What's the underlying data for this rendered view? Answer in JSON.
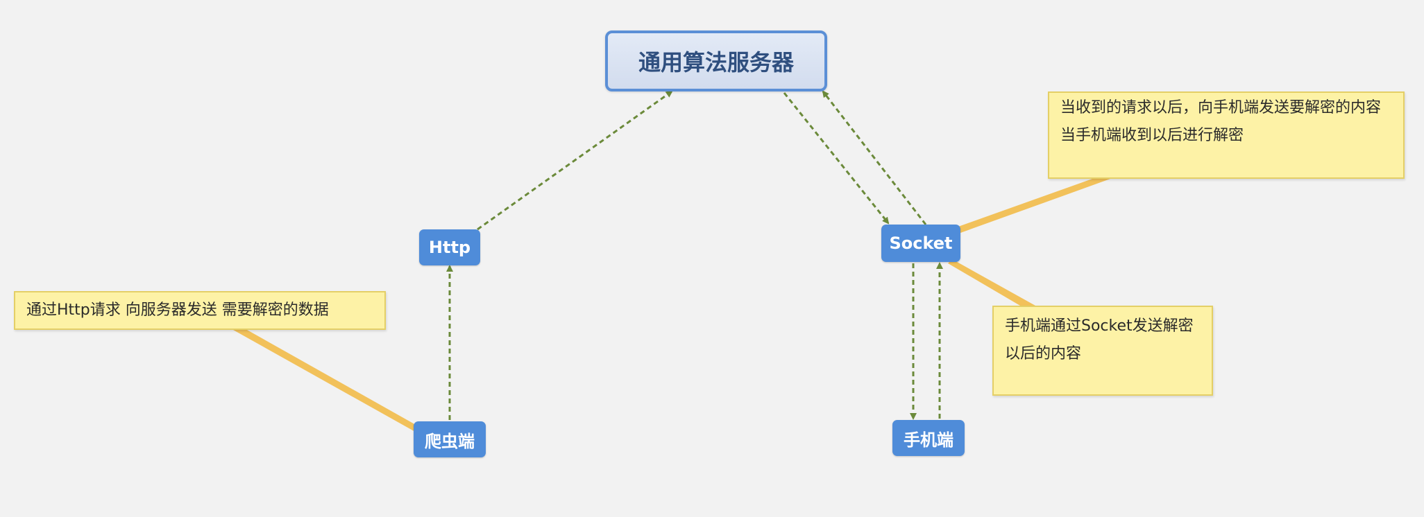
{
  "nodes": {
    "server": "通用算法服务器",
    "http": "Http",
    "socket": "Socket",
    "spider": "爬虫端",
    "mobile": "手机端"
  },
  "notes": {
    "http_request": "通过Http请求 向服务器发送 需要解密的数据",
    "server_to_mobile": "当收到的请求以后，向手机端发送要解密的内容 当手机端收到以后进行解密",
    "mobile_to_server": "手机端通过Socket发送解密以后的内容"
  },
  "colors": {
    "node_fill": "#4f8cd9",
    "server_border": "#5b8fd6",
    "note_fill": "#fdf2a6",
    "arrow": "#6b8a3a",
    "callout": "#f2c15a"
  }
}
